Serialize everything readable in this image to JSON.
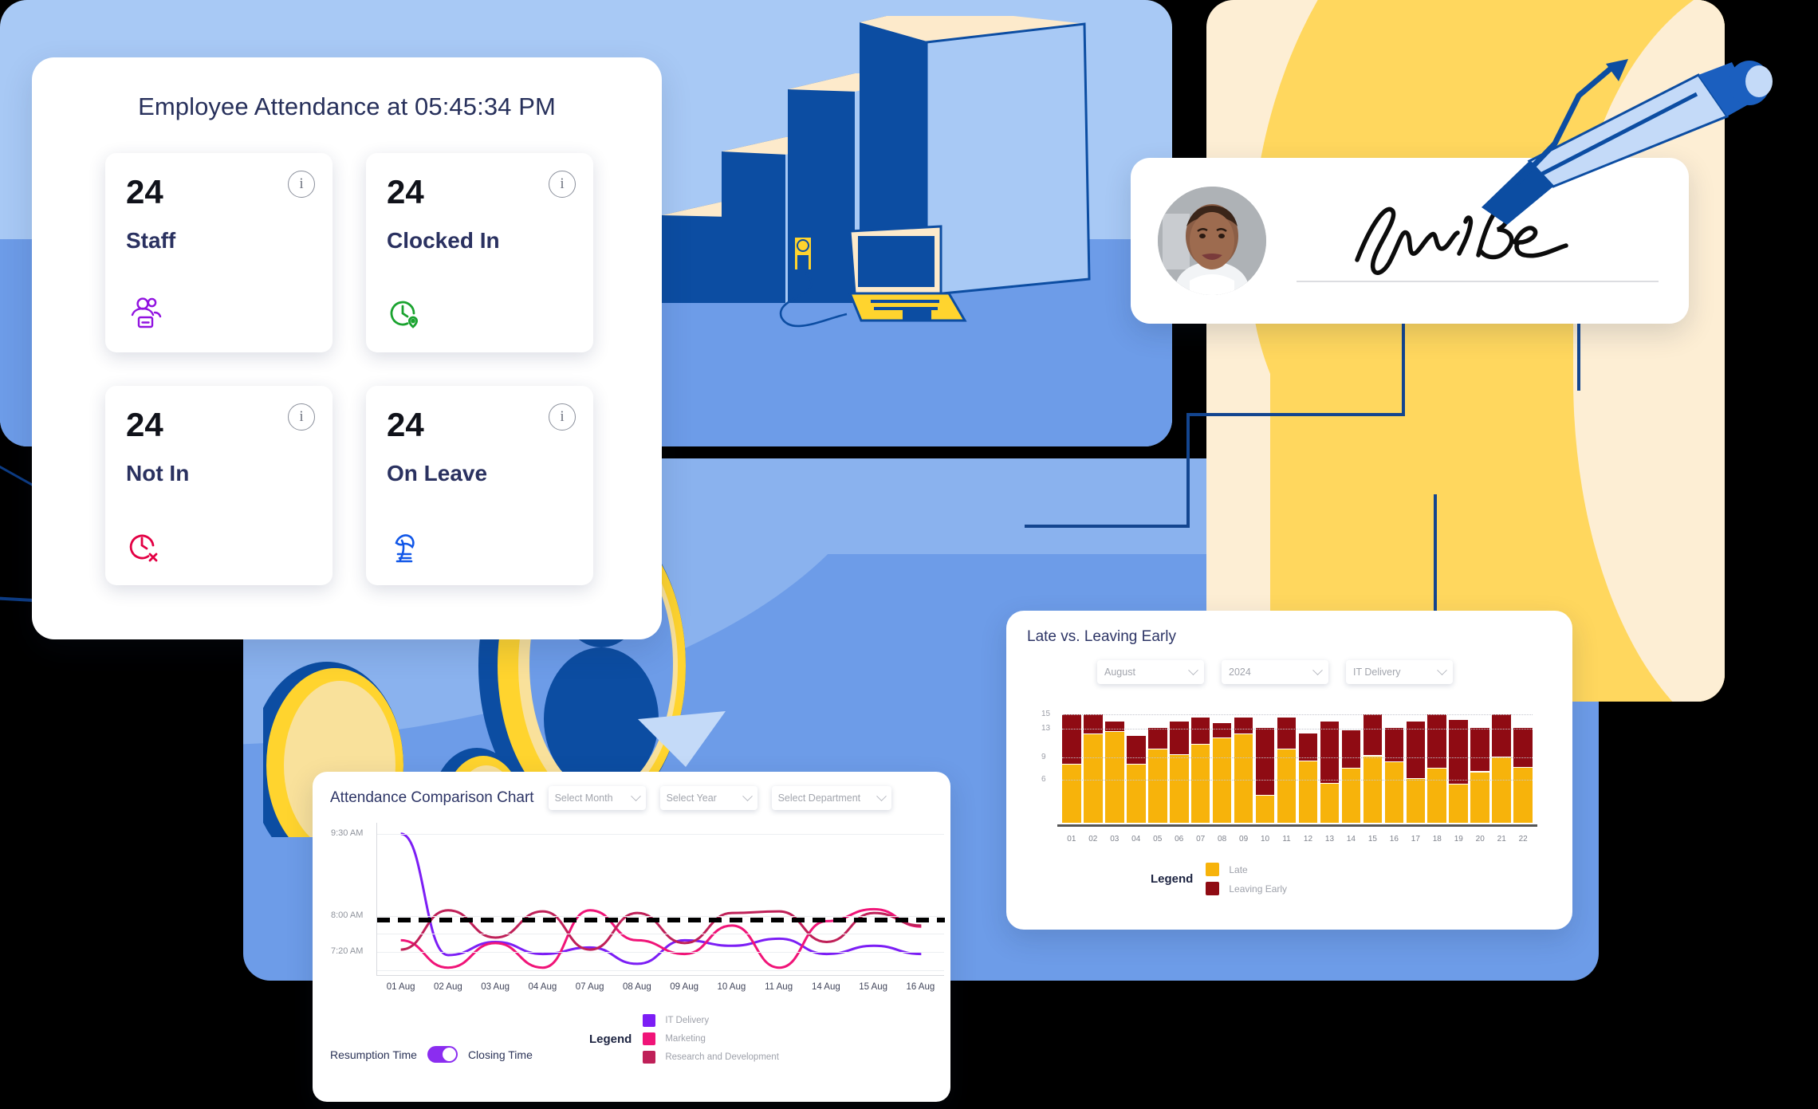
{
  "attendance_panel": {
    "title": "Employee Attendance at 05:45:34 PM",
    "info_glyph": "i",
    "cards": [
      {
        "value": "24",
        "label": "Staff",
        "icon": "people-badge-icon",
        "icon_color": "#9112e0"
      },
      {
        "value": "24",
        "label": "Clocked In",
        "icon": "clock-location-icon",
        "icon_color": "#1aa32f"
      },
      {
        "value": "24",
        "label": "Not In",
        "icon": "clock-error-icon",
        "icon_color": "#e30044"
      },
      {
        "value": "24",
        "label": "On Leave",
        "icon": "beach-umbrella-icon",
        "icon_color": "#1157e8"
      }
    ]
  },
  "signature_card": {
    "avatar": "user-photo-avatar",
    "signature": "handwritten-signature",
    "pen": "pen-icon"
  },
  "late_card": {
    "title": "Late vs. Leaving Early",
    "filters": [
      {
        "name": "month-select",
        "value": "August"
      },
      {
        "name": "year-select",
        "value": "2024"
      },
      {
        "name": "department-select",
        "value": "IT Delivery"
      }
    ],
    "legend_title": "Legend"
  },
  "comparison_card": {
    "title": "Attendance Comparison Chart",
    "filters": [
      {
        "name": "month-select",
        "value": "Select Month"
      },
      {
        "name": "year-select",
        "value": "Select Year"
      },
      {
        "name": "department-select",
        "value": "Select Department"
      }
    ],
    "toggle": {
      "left_label": "Resumption Time",
      "right_label": "Closing Time",
      "state": "on",
      "color": "#8b2df0"
    },
    "legend_title": "Legend"
  },
  "chart_data": [
    {
      "id": "late-vs-leaving-early",
      "type": "bar",
      "stacked": true,
      "title": "Late vs. Leaving Early",
      "xlabel": "",
      "ylabel": "",
      "ylim": [
        0,
        15
      ],
      "yticks": [
        6,
        9,
        13,
        15
      ],
      "grid": true,
      "legend_position": "bottom",
      "categories": [
        "01",
        "02",
        "03",
        "04",
        "05",
        "06",
        "07",
        "08",
        "09",
        "10",
        "11",
        "12",
        "13",
        "14",
        "15",
        "16",
        "17",
        "18",
        "19",
        "20",
        "21",
        "22"
      ],
      "series": [
        {
          "name": "Late",
          "color": "#f7b30b",
          "values": [
            8.0,
            12.2,
            12.6,
            8.0,
            10.1,
            9.4,
            10.8,
            11.7,
            12.2,
            3.7,
            10.1,
            8.5,
            5.4,
            7.5,
            9.2,
            8.4,
            6.1,
            7.5,
            5.3,
            7.0,
            9.0,
            7.6
          ]
        },
        {
          "name": "Leaving Early",
          "color": "#8f0b13",
          "values": [
            15.0,
            15.0,
            14.0,
            12.0,
            13.1,
            14.0,
            14.6,
            13.8,
            14.6,
            13.1,
            14.6,
            12.4,
            14.0,
            12.8,
            15.0,
            13.1,
            14.0,
            15.0,
            14.2,
            13.1,
            15.0,
            13.1
          ]
        }
      ]
    },
    {
      "id": "attendance-comparison",
      "type": "line",
      "title": "Attendance Comparison Chart",
      "xlabel": "",
      "ylabel": "",
      "yticks": [
        "7:20 AM",
        "8:00 AM",
        "9:30 AM"
      ],
      "threshold_line": "7:55 AM",
      "grid": true,
      "legend_position": "bottom-right",
      "x": [
        "01 Aug",
        "02 Aug",
        "03 Aug",
        "04 Aug",
        "07 Aug",
        "08 Aug",
        "09 Aug",
        "10 Aug",
        "11 Aug",
        "14 Aug",
        "15 Aug",
        "16 Aug"
      ],
      "series": [
        {
          "name": "IT Delivery",
          "color": "#7c1ef5",
          "values": [
            9.5,
            7.28,
            7.52,
            7.3,
            7.42,
            7.12,
            7.55,
            7.45,
            7.58,
            7.3,
            7.45,
            7.3
          ]
        },
        {
          "name": "Marketing",
          "color": "#f01478",
          "values": [
            7.55,
            7.05,
            7.5,
            7.05,
            8.1,
            7.55,
            7.3,
            7.82,
            7.05,
            7.9,
            8.12,
            7.8
          ]
        },
        {
          "name": "Research and Development",
          "color": "#bf2058",
          "values": [
            7.38,
            8.1,
            7.6,
            8.08,
            7.38,
            8.05,
            7.5,
            8.05,
            8.08,
            7.52,
            8.05,
            7.82
          ]
        }
      ]
    }
  ]
}
